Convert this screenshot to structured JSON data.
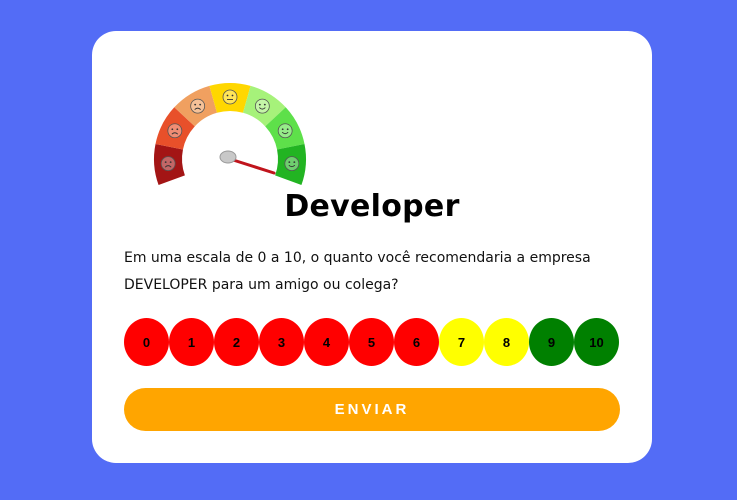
{
  "survey": {
    "title": "Developer",
    "question": "Em uma escala de 0 a 10, o quanto você recomendaria a empresa DEVELOPER para um amigo ou colega?",
    "scores": [
      {
        "label": "0",
        "color": "#ff0000"
      },
      {
        "label": "1",
        "color": "#ff0000"
      },
      {
        "label": "2",
        "color": "#ff0000"
      },
      {
        "label": "3",
        "color": "#ff0000"
      },
      {
        "label": "4",
        "color": "#ff0000"
      },
      {
        "label": "5",
        "color": "#ff0000"
      },
      {
        "label": "6",
        "color": "#ff0000"
      },
      {
        "label": "7",
        "color": "#ffff00"
      },
      {
        "label": "8",
        "color": "#ffff00"
      },
      {
        "label": "9",
        "color": "#008000"
      },
      {
        "label": "10",
        "color": "#008000"
      }
    ],
    "submit_label": "ENVIAR"
  },
  "gauge": {
    "icon": "satisfaction-gauge-icon",
    "segment_colors": [
      "#a31515",
      "#e8502a",
      "#f0a060",
      "#ffd700",
      "#a6f27a",
      "#5ee04a",
      "#22b422"
    ],
    "needle_color": "#c0141c"
  },
  "colors": {
    "background": "#536cf6",
    "card": "#ffffff",
    "button": "#ffa500"
  }
}
